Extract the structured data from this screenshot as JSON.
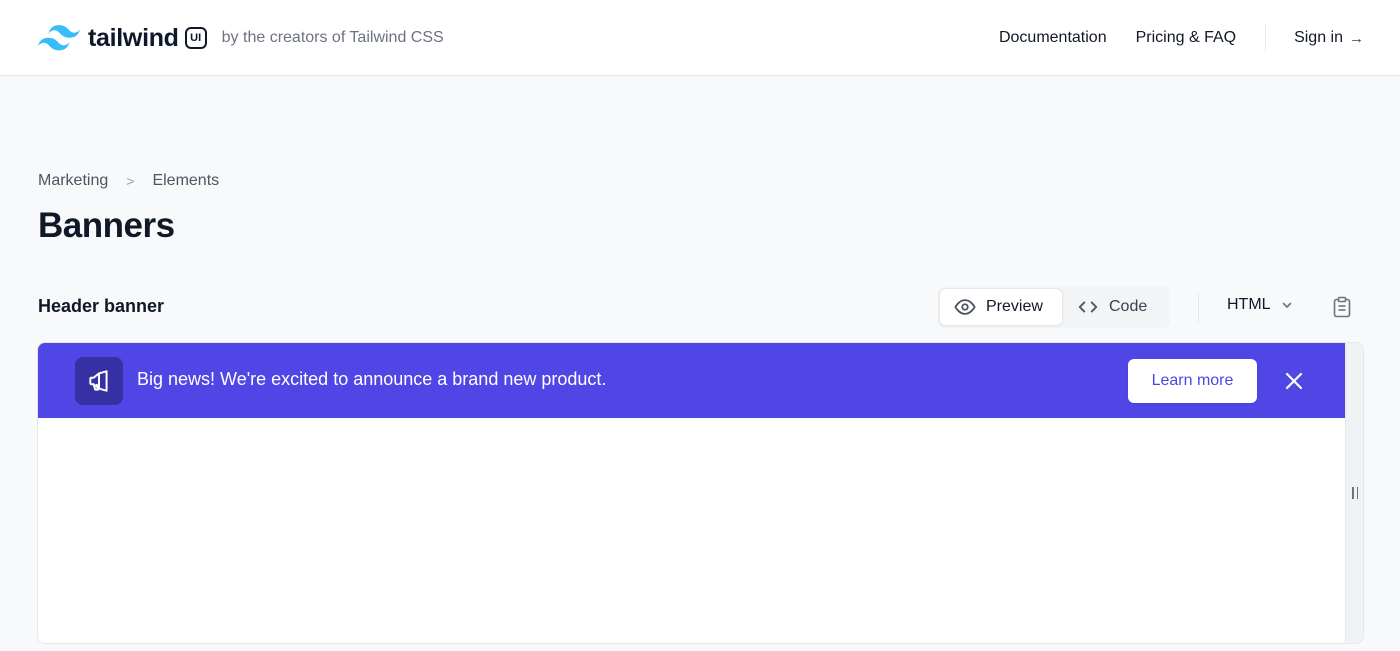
{
  "header": {
    "brand_name": "tailwind",
    "brand_badge": "UI",
    "tagline": "by the creators of Tailwind CSS",
    "nav": [
      {
        "label": "Documentation"
      },
      {
        "label": "Pricing & FAQ"
      }
    ],
    "signin_label": "Sign in",
    "signin_arrow": "→"
  },
  "breadcrumb": {
    "items": [
      "Marketing",
      "Elements"
    ],
    "separator": ">"
  },
  "page_title": "Banners",
  "section": {
    "title": "Header banner",
    "tabs": [
      {
        "label": "Preview",
        "icon": "eye-icon",
        "active": true
      },
      {
        "label": "Code",
        "icon": "code-icon",
        "active": false
      }
    ],
    "language": "HTML",
    "copy_icon": "clipboard-icon"
  },
  "preview": {
    "banner": {
      "text": "Big news! We're excited to announce a brand new product.",
      "cta_label": "Learn more",
      "icon": "megaphone-icon",
      "close_icon": "close-icon"
    },
    "resize_handle_icon": "drag-handle-icon"
  },
  "colors": {
    "accent": "#4f46e5",
    "accent_dark": "#3730a3",
    "logo": "#38bdf8"
  }
}
